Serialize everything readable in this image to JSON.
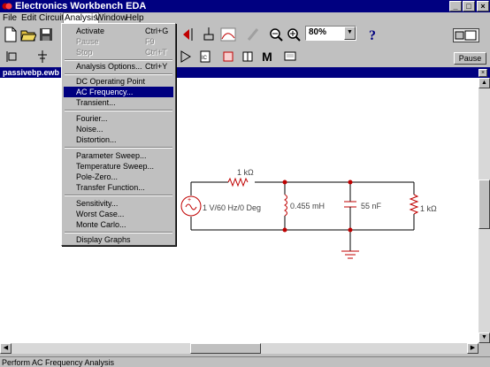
{
  "window": {
    "title": "Electronics Workbench EDA"
  },
  "menubar": [
    "File",
    "Edit",
    "Circuit",
    "Analysis",
    "Window",
    "Help"
  ],
  "toolbar": {
    "zoom": "80%",
    "pause_label": "Pause",
    "power_label": "O",
    "components_label": "M"
  },
  "analysis_menu": {
    "items": [
      {
        "label": "Activate",
        "shortcut": "Ctrl+G",
        "enabled": true
      },
      {
        "label": "Pause",
        "shortcut": "F9",
        "enabled": false
      },
      {
        "label": "Stop",
        "shortcut": "Ctrl+T",
        "enabled": false
      },
      {
        "label": "Analysis Options...",
        "shortcut": "Ctrl+Y",
        "enabled": true
      },
      {
        "label": "DC Operating Point",
        "shortcut": "",
        "enabled": true
      },
      {
        "label": "AC Frequency...",
        "shortcut": "",
        "enabled": true,
        "selected": true
      },
      {
        "label": "Transient...",
        "shortcut": "",
        "enabled": true
      },
      {
        "label": "Fourier...",
        "shortcut": "",
        "enabled": true
      },
      {
        "label": "Noise...",
        "shortcut": "",
        "enabled": true
      },
      {
        "label": "Distortion...",
        "shortcut": "",
        "enabled": true
      },
      {
        "label": "Parameter Sweep...",
        "shortcut": "",
        "enabled": true
      },
      {
        "label": "Temperature Sweep...",
        "shortcut": "",
        "enabled": true
      },
      {
        "label": "Pole-Zero...",
        "shortcut": "",
        "enabled": true
      },
      {
        "label": "Transfer Function...",
        "shortcut": "",
        "enabled": true
      },
      {
        "label": "Sensitivity...",
        "shortcut": "",
        "enabled": true
      },
      {
        "label": "Worst Case...",
        "shortcut": "",
        "enabled": true
      },
      {
        "label": "Monte Carlo...",
        "shortcut": "",
        "enabled": true
      },
      {
        "label": "Display Graphs",
        "shortcut": "",
        "enabled": true
      }
    ]
  },
  "document": {
    "title": "passivebp.ewb"
  },
  "circuit": {
    "source_label": "1 V/60 Hz/0 Deg",
    "series_resistor": "1 kΩ",
    "inductor": "0.455 mH",
    "capacitor": "55 nF",
    "load_resistor": "1 kΩ"
  },
  "status": "Perform AC Frequency Analysis"
}
